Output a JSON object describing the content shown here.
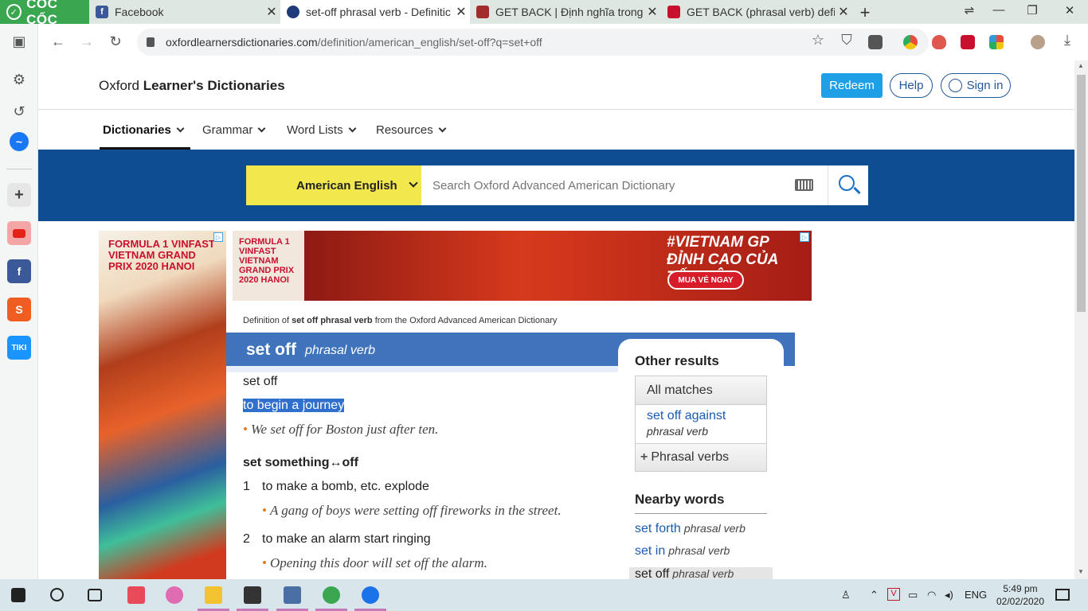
{
  "browser": {
    "brand": "CỐC CỐC",
    "tabs": [
      {
        "title": "Facebook",
        "active": false
      },
      {
        "title": "set-off phrasal verb - Definitic",
        "active": true
      },
      {
        "title": "GET BACK | Định nghĩa trong",
        "active": false
      },
      {
        "title": "GET BACK (phrasal verb) defir",
        "active": false
      }
    ],
    "url_host": "oxfordlearnersdictionaries.com",
    "url_path": "/definition/american_english/set-off?q=set+off"
  },
  "site": {
    "logo_prefix": "Oxford",
    "logo_main": "Learner's Dictionaries",
    "redeem_label": "Redeem",
    "help_label": "Help",
    "signin_label": "Sign in",
    "menu": [
      "Dictionaries",
      "Grammar",
      "Word Lists",
      "Resources"
    ],
    "dict_select": "American English",
    "search_placeholder": "Search Oxford Advanced American Dictionary"
  },
  "ads": {
    "vertical_text": "FORMULA 1 VINFAST VIETNAM GRAND PRIX 2020 HANOI",
    "horizontal_text": "FORMULA 1 VINFAST VIETNAM GRAND PRIX 2020 HANOI",
    "slogan_1": "#VIETNAM GP",
    "slogan_2": "ĐỈNH CAO CỦA TỐC ĐỘ.",
    "buy_label": "MUA VÉ NGAY"
  },
  "entry": {
    "definition_of_prefix": "Definition of",
    "definition_of_word": "set off phrasal verb",
    "definition_of_suffix": "from the Oxford Advanced American Dictionary",
    "headword": "set off",
    "pos": "phrasal verb",
    "sense1_head": "set off",
    "sense1_def": "to begin a journey",
    "sense1_example": "We set off for Boston just after ten.",
    "sense2_head": "set something↔off",
    "sense2_items": [
      {
        "num": "1",
        "def": "to make a bomb, etc. explode",
        "example": "A gang of boys were setting off fireworks in the street."
      },
      {
        "num": "2",
        "def": "to make an alarm start ringing",
        "example": "Opening this door will set off the alarm."
      }
    ]
  },
  "panel": {
    "other_results_title": "Other results",
    "all_matches_label": "All matches",
    "match_word": "set off against",
    "match_pos": "phrasal verb",
    "phrasal_verbs_label": "Phrasal verbs",
    "nearby_title": "Nearby words",
    "nearby": [
      {
        "word": "set forth",
        "pos": "phrasal verb"
      },
      {
        "word": "set in",
        "pos": "phrasal verb"
      },
      {
        "word": "set off",
        "pos": "phrasal verb"
      }
    ]
  },
  "taskbar": {
    "language": "ENG",
    "time": "5:49 pm",
    "date": "02/02/2020"
  },
  "colors": {
    "oxford_blue": "#0e4d92",
    "entry_blue": "#3f74bd",
    "selector_yellow": "#f2e84e",
    "coccoc_green": "#3aa650"
  }
}
